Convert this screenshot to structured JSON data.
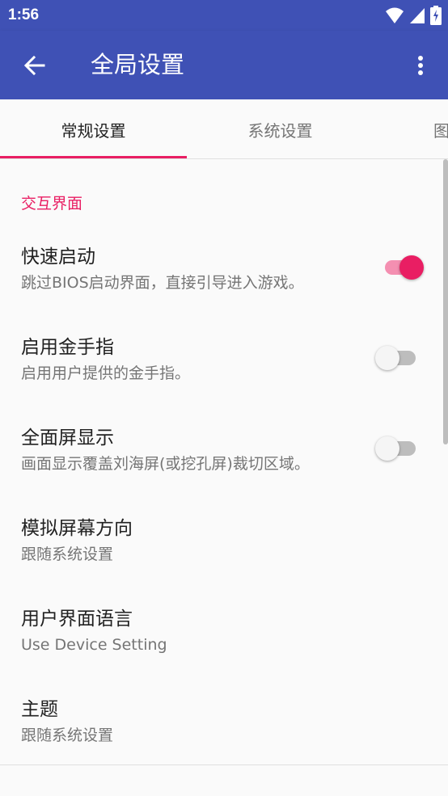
{
  "status_bar": {
    "time": "1:56"
  },
  "app_bar": {
    "title": "全局设置"
  },
  "tabs": [
    {
      "label": "常规设置",
      "active": true
    },
    {
      "label": "系统设置",
      "active": false
    },
    {
      "label": "图",
      "active": false
    }
  ],
  "section": {
    "title": "交互界面"
  },
  "settings": [
    {
      "title": "快速启动",
      "subtitle": "跳过BIOS启动界面，直接引导进入游戏。",
      "toggle": true
    },
    {
      "title": "启用金手指",
      "subtitle": "启用用户提供的金手指。",
      "toggle": false
    },
    {
      "title": "全面屏显示",
      "subtitle": "画面显示覆盖刘海屏(或挖孔屏)裁切区域。",
      "toggle": false
    },
    {
      "title": "模拟屏幕方向",
      "subtitle": "跟随系统设置"
    },
    {
      "title": "用户界面语言",
      "subtitle": "Use Device Setting"
    },
    {
      "title": "主题",
      "subtitle": "跟随系统设置"
    }
  ],
  "colors": {
    "primary": "#3f51b5",
    "accent": "#e91e63",
    "background": "#fafafa"
  },
  "icons": [
    "wifi-icon",
    "signal-icon",
    "battery-icon",
    "back-arrow-icon",
    "more-vert-icon"
  ]
}
